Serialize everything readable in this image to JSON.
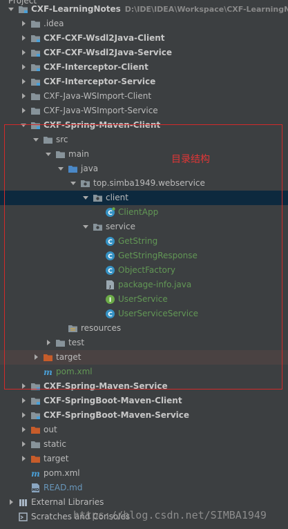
{
  "panel": {
    "title": "Project",
    "annotation": "目录结构",
    "watermark": "https://blog.csdn.net/SIMBA1949"
  },
  "colors": {
    "background": "#3c3f41",
    "selection": "#0d293e",
    "folder": "#87939a",
    "excluded_folder": "#c75c2a",
    "class_icon": "#3592c4",
    "interface_icon": "#6cab48",
    "green_text": "#629755",
    "annotation_red": "#e23636"
  },
  "tree": [
    {
      "id": "root",
      "label": "CXF-LearningNotes",
      "path": "D:\\IDE\\IDEA\\Workspace\\CXF-LearningNc",
      "depth": 0,
      "arrow": "down",
      "icon": "module-folder-icon",
      "bold": true
    },
    {
      "id": "idea",
      "label": ".idea",
      "depth": 1,
      "arrow": "right",
      "icon": "folder-icon"
    },
    {
      "id": "wsdl2java-client",
      "label": "CXF-CXF-Wsdl2Java-Client",
      "depth": 1,
      "arrow": "right",
      "icon": "module-folder-icon",
      "bold": true
    },
    {
      "id": "wsdl2java-service",
      "label": "CXF-CXF-Wsdl2Java-Service",
      "depth": 1,
      "arrow": "right",
      "icon": "module-folder-icon",
      "bold": true
    },
    {
      "id": "interceptor-client",
      "label": "CXF-Interceptor-Client",
      "depth": 1,
      "arrow": "right",
      "icon": "module-folder-icon",
      "bold": true
    },
    {
      "id": "interceptor-service",
      "label": "CXF-Interceptor-Service",
      "depth": 1,
      "arrow": "right",
      "icon": "module-folder-icon",
      "bold": true
    },
    {
      "id": "wsimport-client",
      "label": "CXF-Java-WSImport-Client",
      "depth": 1,
      "arrow": "right",
      "icon": "folder-icon"
    },
    {
      "id": "wsimport-service",
      "label": "CXF-Java-WSImport-Service",
      "depth": 1,
      "arrow": "right",
      "icon": "folder-icon"
    },
    {
      "id": "spring-maven-client",
      "label": "CXF-Spring-Maven-Client",
      "depth": 1,
      "arrow": "down",
      "icon": "module-folder-icon",
      "bold": true
    },
    {
      "id": "src",
      "label": "src",
      "depth": 2,
      "arrow": "down",
      "icon": "folder-icon"
    },
    {
      "id": "main",
      "label": "main",
      "depth": 3,
      "arrow": "down",
      "icon": "folder-icon"
    },
    {
      "id": "java",
      "label": "java",
      "depth": 4,
      "arrow": "down",
      "icon": "source-folder-icon"
    },
    {
      "id": "package",
      "label": "top.simba1949.webservice",
      "depth": 5,
      "arrow": "down",
      "icon": "package-icon"
    },
    {
      "id": "client",
      "label": "client",
      "depth": 6,
      "arrow": "down",
      "icon": "package-icon",
      "selected": true
    },
    {
      "id": "client-app",
      "label": "ClientApp",
      "depth": 7,
      "icon": "runnable-class-icon",
      "green": true
    },
    {
      "id": "service",
      "label": "service",
      "depth": 6,
      "arrow": "down",
      "icon": "package-icon"
    },
    {
      "id": "get-string",
      "label": "GetString",
      "depth": 7,
      "icon": "class-icon",
      "green": true
    },
    {
      "id": "get-string-response",
      "label": "GetStringResponse",
      "depth": 7,
      "icon": "class-icon",
      "green": true
    },
    {
      "id": "object-factory",
      "label": "ObjectFactory",
      "depth": 7,
      "icon": "class-icon",
      "green": true
    },
    {
      "id": "package-info",
      "label": "package-info.java",
      "depth": 7,
      "icon": "java-file-icon",
      "green": true
    },
    {
      "id": "user-service",
      "label": "UserService",
      "depth": 7,
      "icon": "interface-icon",
      "green": true
    },
    {
      "id": "user-service-service",
      "label": "UserServiceService",
      "depth": 7,
      "icon": "class-icon",
      "green": true
    },
    {
      "id": "resources",
      "label": "resources",
      "depth": 4,
      "icon": "resources-folder-icon"
    },
    {
      "id": "test",
      "label": "test",
      "depth": 3,
      "arrow": "right",
      "icon": "folder-icon"
    },
    {
      "id": "target-inner",
      "label": "target",
      "depth": 2,
      "arrow": "right",
      "icon": "excluded-folder-icon",
      "tinted": true
    },
    {
      "id": "pom-inner",
      "label": "pom.xml",
      "depth": 2,
      "icon": "maven-icon",
      "green": true
    },
    {
      "id": "spring-maven-service",
      "label": "CXF-Spring-Maven-Service",
      "depth": 1,
      "arrow": "right",
      "icon": "module-folder-icon",
      "bold": true
    },
    {
      "id": "springboot-maven-client",
      "label": "CXF-SpringBoot-Maven-Client",
      "depth": 1,
      "arrow": "right",
      "icon": "module-folder-icon",
      "bold": true
    },
    {
      "id": "springboot-maven-service",
      "label": "CXF-SpringBoot-Maven-Service",
      "depth": 1,
      "arrow": "right",
      "icon": "module-folder-icon",
      "bold": true
    },
    {
      "id": "out",
      "label": "out",
      "depth": 1,
      "arrow": "right",
      "icon": "excluded-folder-icon",
      "tinted": true
    },
    {
      "id": "static",
      "label": "static",
      "depth": 1,
      "arrow": "right",
      "icon": "folder-icon"
    },
    {
      "id": "target-root",
      "label": "target",
      "depth": 1,
      "arrow": "right",
      "icon": "excluded-folder-icon",
      "tinted": true
    },
    {
      "id": "pom-root",
      "label": "pom.xml",
      "depth": 1,
      "icon": "maven-icon"
    },
    {
      "id": "readme",
      "label": "READ.md",
      "depth": 1,
      "icon": "markdown-icon",
      "blue": true
    },
    {
      "id": "external-libraries",
      "label": "External Libraries",
      "depth": 0,
      "arrow": "right",
      "icon": "libraries-icon"
    },
    {
      "id": "scratches",
      "label": "Scratches and Consoles",
      "depth": 0,
      "icon": "scratches-icon"
    }
  ]
}
